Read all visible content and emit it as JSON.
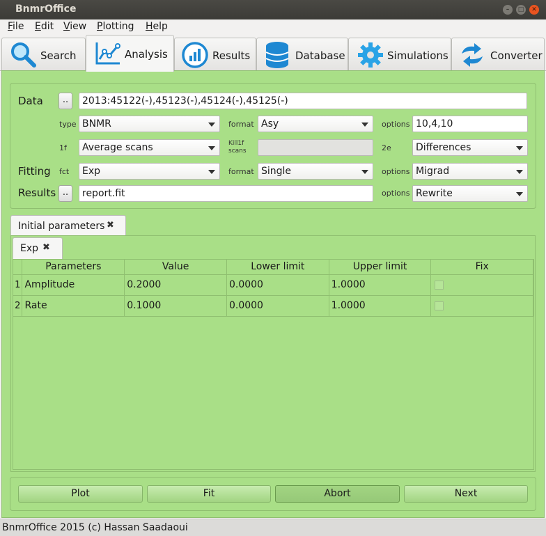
{
  "window": {
    "title": "BnmrOffice"
  },
  "menu": [
    "File",
    "Edit",
    "View",
    "Plotting",
    "Help"
  ],
  "tabs": [
    {
      "label": "Search",
      "icon": "search-icon"
    },
    {
      "label": "Analysis",
      "icon": "line-chart-icon",
      "active": true
    },
    {
      "label": "Results",
      "icon": "bar-chart-icon"
    },
    {
      "label": "Database",
      "icon": "database-icon"
    },
    {
      "label": "Simulations",
      "icon": "gear-icon"
    },
    {
      "label": "Converter",
      "icon": "convert-arrows-icon"
    }
  ],
  "data_section": {
    "label": "Data",
    "browse": "..",
    "runs": "2013:45122(-),45123(-),45124(-),45125(-)",
    "type_label": "type",
    "type_value": "BNMR",
    "format_label": "format",
    "format_value": "Asy",
    "options_label": "options",
    "options_value": "10,4,10",
    "f1_label": "1f",
    "f1_value": "Average scans",
    "kill_label": "Kill1f scans",
    "kill_value": "",
    "e2_label": "2e",
    "e2_value": "Differences"
  },
  "fitting_section": {
    "label": "Fitting",
    "fct_label": "fct",
    "fct_value": "Exp",
    "format_label": "format",
    "format_value": "Single",
    "options_label": "options",
    "options_value": "Migrad"
  },
  "results_section": {
    "label": "Results",
    "browse": "..",
    "file": "report.fit",
    "options_label": "options",
    "options_value": "Rewrite"
  },
  "params_tab": {
    "label": "Initial parameters"
  },
  "func_tab": {
    "label": "Exp"
  },
  "table": {
    "columns": [
      "Parameters",
      "Value",
      "Lower limit",
      "Upper limit",
      "Fix"
    ],
    "rows": [
      {
        "num": "1",
        "name": "Amplitude",
        "value": "0.2000",
        "lower": "0.0000",
        "upper": "1.0000",
        "fix": false
      },
      {
        "num": "2",
        "name": "Rate",
        "value": "0.1000",
        "lower": "0.0000",
        "upper": "1.0000",
        "fix": false
      }
    ]
  },
  "actions": {
    "plot": "Plot",
    "fit": "Fit",
    "abort": "Abort",
    "next": "Next"
  },
  "status": "BnmrOffice 2015 (c) Hassan Saadaoui",
  "colors": {
    "panel": "#a9df87",
    "titlebar": "#3c3b37",
    "close_button": "#e95420"
  }
}
